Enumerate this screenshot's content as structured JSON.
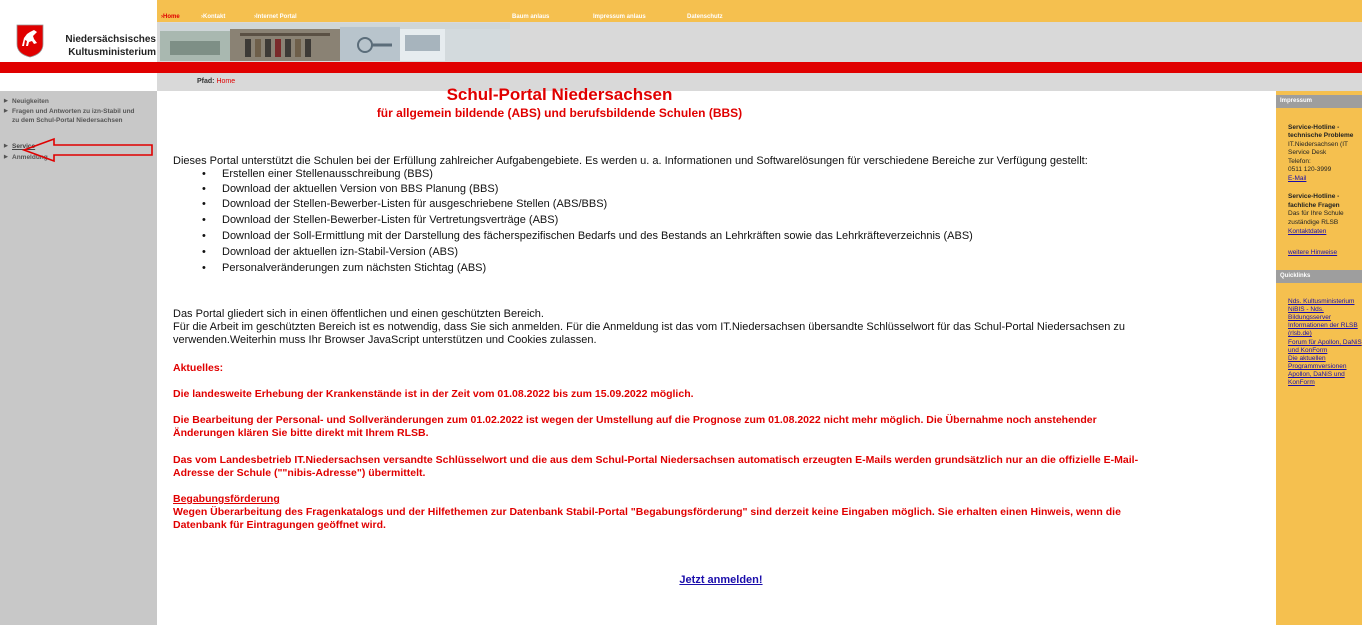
{
  "header": {
    "logo_line1": "Niedersächsisches",
    "logo_line2": "Kultusministerium",
    "nav_home": "›Home",
    "nav_kontakt": "›Kontakt",
    "nav_internet": "›Internet Portal",
    "nav_baum": "Baum anlaus",
    "nav_impressum": "Impressum anlaus",
    "nav_datenschutz": "Datenschutz",
    "path_label": "Pfad:",
    "path_home": "Home"
  },
  "sidebar": {
    "items": [
      {
        "label": "Neuigkeiten"
      },
      {
        "label": "Fragen und Antworten zu izn-Stabil und zu dem Schul-Portal Niedersachsen"
      },
      {
        "label": "Service"
      },
      {
        "label": "Anmeldung"
      }
    ]
  },
  "main": {
    "title": "Schul-Portal Niedersachsen",
    "subtitle": "für allgemein bildende (ABS) und berufsbildende Schulen (BBS)",
    "intro": "Dieses Portal unterstützt die Schulen bei der Erfüllung zahlreicher Aufgabengebiete. Es werden u. a. Informationen und Softwarelösungen für verschiedene Bereiche zur Verfügung gestellt:",
    "bullets": [
      "Erstellen einer Stellenausschreibung (BBS)",
      "Download der aktuellen Version von BBS Planung (BBS)",
      "Download der Stellen-Bewerber-Listen für ausgeschriebene Stellen (ABS/BBS)",
      "Download der Stellen-Bewerber-Listen für Vertretungsverträge (ABS)",
      "Download der Soll-Ermittlung mit der Darstellung des fächerspezifischen Bedarfs und des Bestands an Lehrkräften sowie das Lehrkräfteverzeichnis (ABS)",
      "Download der aktuellen izn-Stabil-Version (ABS)",
      "Personalveränderungen zum nächsten Stichtag (ABS)"
    ],
    "portal_line1": "Das Portal gliedert sich in einen öffentlichen und einen geschützten Bereich.",
    "portal_line2": "Für die Arbeit im geschützten Bereich ist es notwendig, dass Sie sich anmelden. Für die Anmeldung ist das vom IT.Niedersachsen übersandte Schlüsselwort für das Schul-Portal Niedersachsen zu",
    "portal_line3": "verwenden.Weiterhin muss Ihr Browser JavaScript unterstützen und Cookies zulassen.",
    "aktuelles": "Aktuelles:",
    "news1": "Die landesweite Erhebung der Krankenstände ist in der Zeit vom 01.08.2022 bis zum 15.09.2022 möglich.",
    "news2a": "Die Bearbeitung der Personal- und Sollveränderungen zum 01.02.2022 ist wegen der Umstellung auf die Prognose zum 01.08.2022 nicht mehr möglich. Die Übernahme noch anstehender",
    "news2b": "Änderungen klären Sie bitte direkt mit Ihrem RLSB.",
    "news3a": "Das vom Landesbetrieb IT.Niedersachsen versandte Schlüsselwort und die aus dem Schul-Portal Niedersachsen automatisch erzeugten E-Mails werden grundsätzlich nur an die offizielle E-Mail-",
    "news3b": "Adresse der Schule (\"\"nibis-Adresse\") übermittelt.",
    "begabung_title": "Begabungsförderung",
    "begabung_a": "Wegen Überarbeitung des Fragenkatalogs und der Hilfethemen zur Datenbank Stabil-Portal \"Begabungsförderung\" sind derzeit keine Eingaben möglich. Sie erhalten einen Hinweis, wenn die",
    "begabung_b": "Datenbank für Eintragungen geöffnet wird.",
    "cta": "Jetzt anmelden!"
  },
  "rightbar": {
    "impressum_header": "Impressum",
    "hotline1_l1": "Service-Hotline -",
    "hotline1_l2": "technische Probleme",
    "hotline1_l3": "IT.Niedersachsen (IT",
    "hotline1_l4": "Service Desk",
    "hotline1_l5": "Telefon:",
    "hotline1_l6": "0511 120-3999",
    "email": "E-Mail",
    "hotline2_l1": "Service-Hotline -",
    "hotline2_l2": "fachliche Fragen",
    "hotline2_l3": "Das für Ihre Schule",
    "hotline2_l4": "zuständige RLSB",
    "kontaktdaten": "Kontaktdaten",
    "weitere": "weitere Hinweise",
    "quicklinks_header": "Quicklinks",
    "links": [
      "Nds. Kultusministerium",
      "NiBIS - Nds.",
      "Bildungsserver",
      "Informationen der RLSB",
      "(rlsb.de)",
      "Forum für Apollon, DaNiS",
      "und KonForm",
      "Die aktuellen",
      "Programmversionen",
      "Apollon, DaNiS und",
      "KonForm"
    ]
  }
}
